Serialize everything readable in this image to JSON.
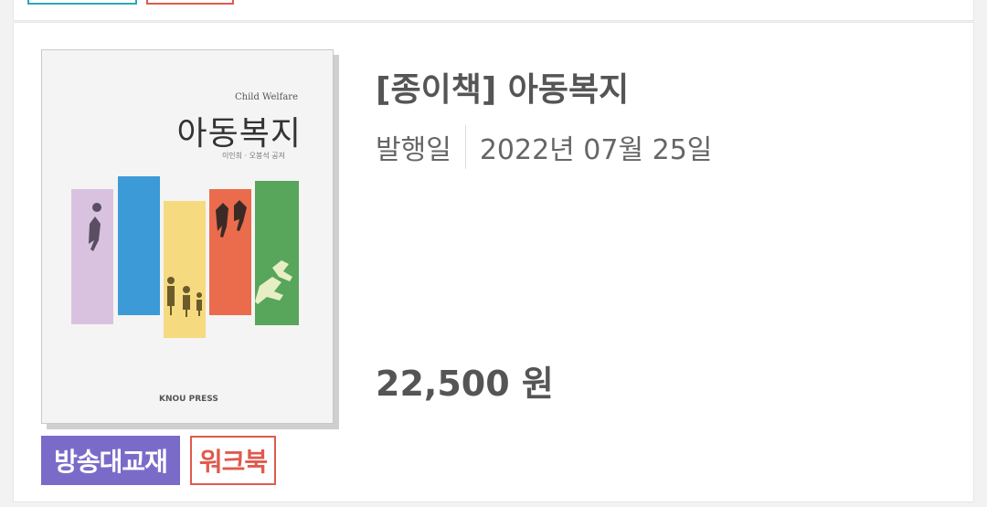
{
  "product": {
    "title": "[종이책] 아동복지",
    "publish_label": "발행일",
    "publish_date": "2022년 07월 25일",
    "price": "22,500 원",
    "badges": [
      "방송대교재",
      "워크북"
    ],
    "cover": {
      "subtitle": "Child Welfare",
      "title": "아동복지",
      "authors": "이인희 · 오봉석 공저",
      "publisher": "KNOU PRESS"
    }
  },
  "colors": {
    "badge_purple": "#7b6bc9",
    "badge_red": "#e05a4e",
    "prev_badge_teal": "#2aa9b3",
    "stripes": [
      "#d9c2e0",
      "#3c9ad6",
      "#f5da80",
      "#ea6c4d",
      "#58a55c"
    ]
  }
}
